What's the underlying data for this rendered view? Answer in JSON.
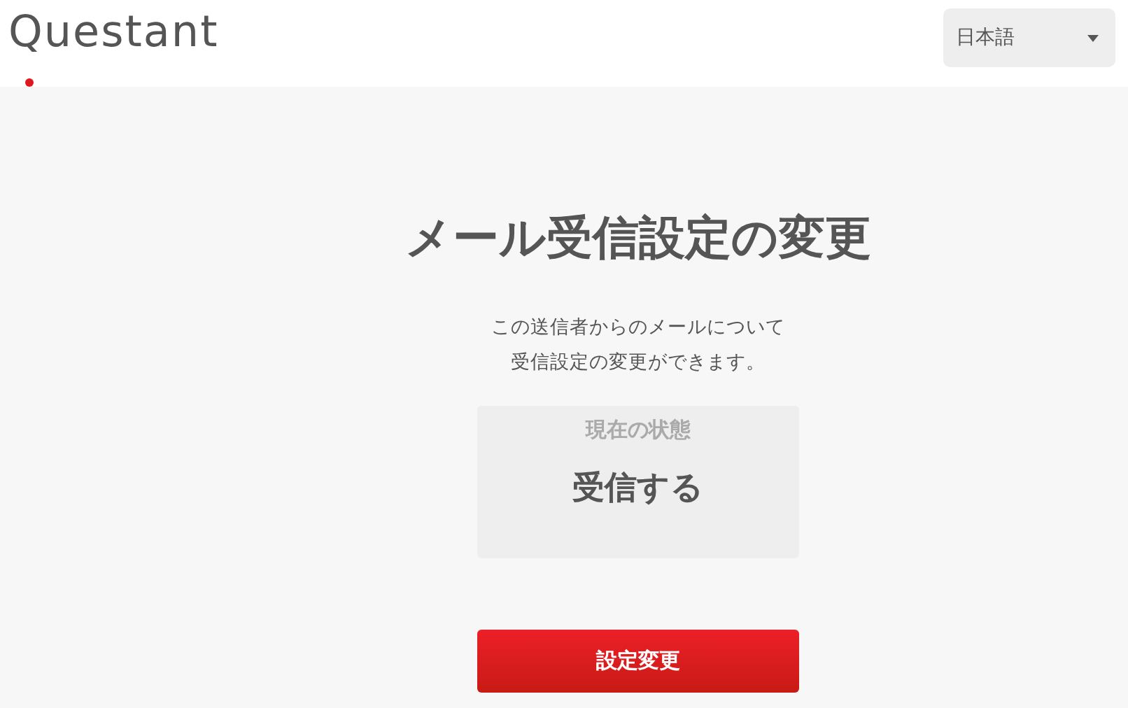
{
  "header": {
    "logo": "Questant",
    "language_select": {
      "value": "日本語"
    }
  },
  "title": "メール受信設定の変更",
  "description": [
    "この送信者からのメールについて",
    "受信設定の変更ができます。"
  ],
  "status": {
    "label": "現在の状態",
    "value": "受信する"
  },
  "button": "設定変更"
}
